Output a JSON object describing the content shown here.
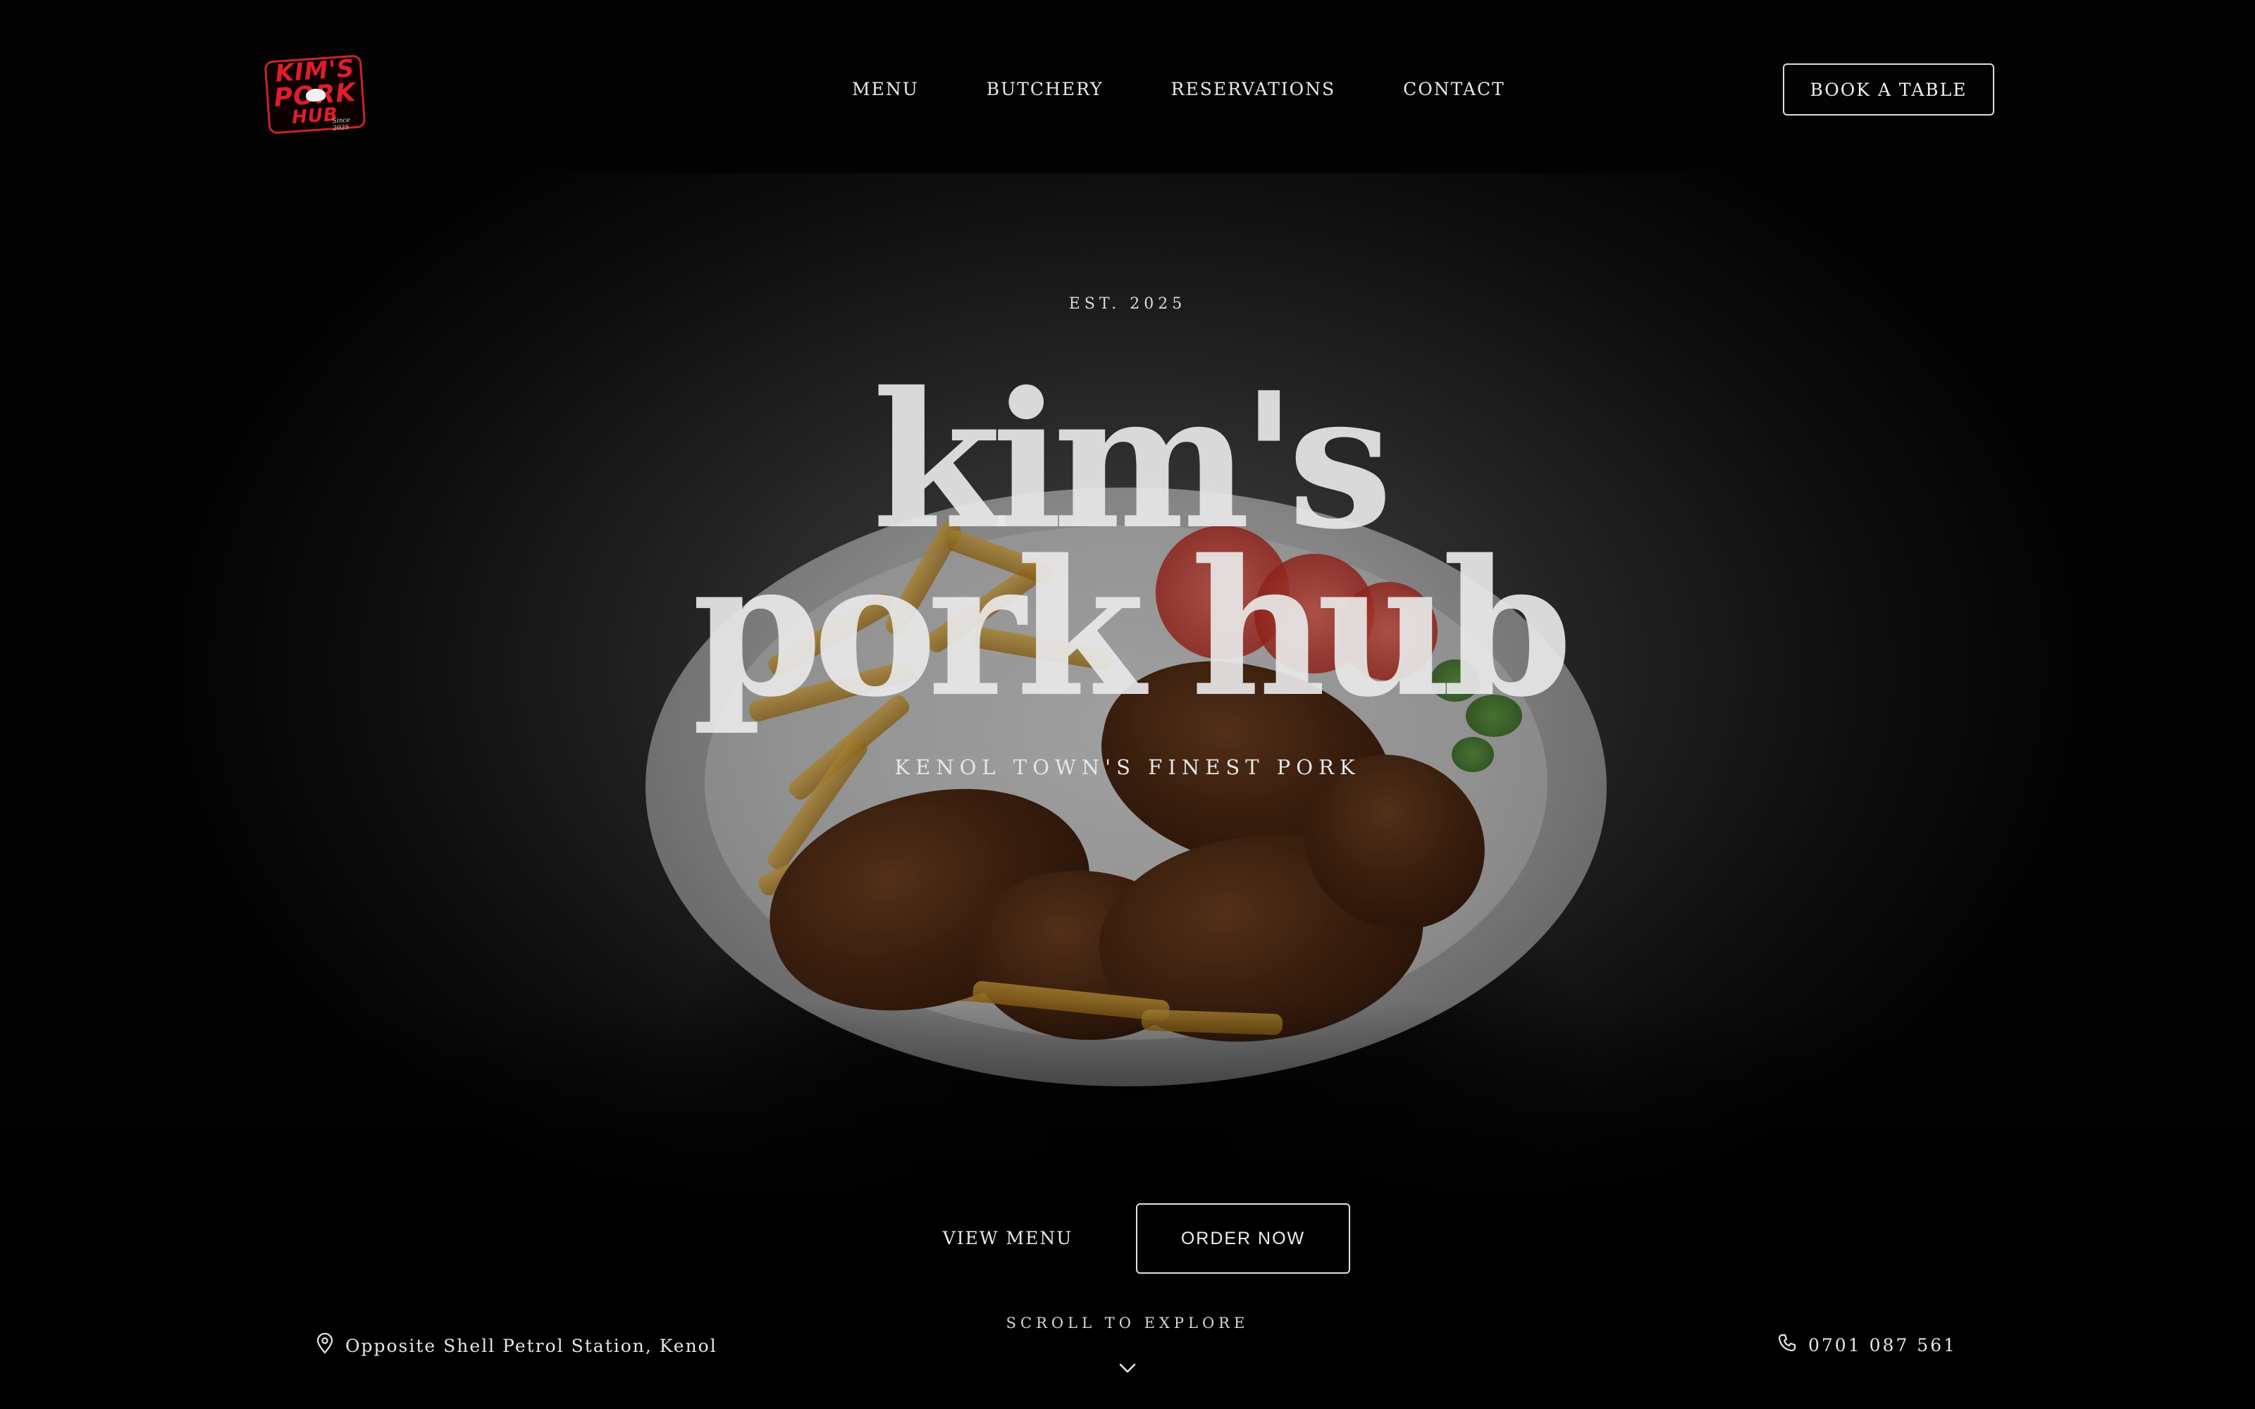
{
  "header": {
    "logo": {
      "line1": "KIM'S",
      "line2": "PORK",
      "line3": "HUB",
      "script": "Since 2025"
    },
    "nav": [
      {
        "label": "MENU"
      },
      {
        "label": "BUTCHERY"
      },
      {
        "label": "RESERVATIONS"
      },
      {
        "label": "CONTACT"
      }
    ],
    "cta_label": "BOOK A TABLE"
  },
  "hero": {
    "eyebrow": "EST. 2025",
    "title_line1": "kim's",
    "title_line2": "pork hub",
    "tagline": "KENOL TOWN'S FINEST PORK",
    "primary_link": "VIEW MENU",
    "secondary_button": "ORDER NOW",
    "background_image": "plate of grilled pork chops with fries, tomato slices and parsley"
  },
  "footer_strip": {
    "address": "Opposite Shell Petrol Station, Kenol",
    "address_icon": "map-pin-icon",
    "scroll_hint": "SCROLL TO EXPLORE",
    "scroll_icon": "chevron-down-icon",
    "phone": "0701 087 561",
    "phone_icon": "phone-icon"
  },
  "colors": {
    "background": "#000000",
    "text": "#e6e6e6",
    "logo_red": "#e11d2a"
  }
}
